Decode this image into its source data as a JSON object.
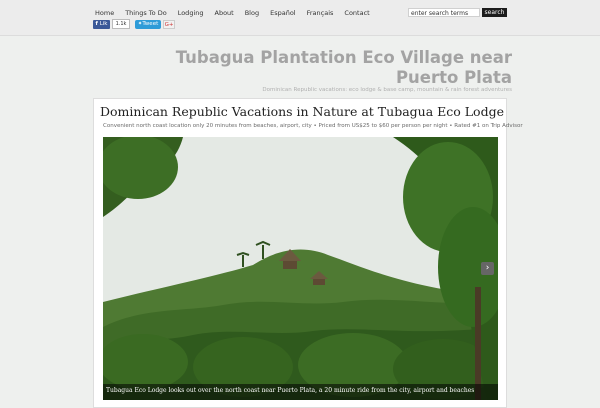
{
  "nav": {
    "items": [
      "Home",
      "Things To Do",
      "Lodging",
      "About",
      "Blog",
      "Español",
      "Français",
      "Contact"
    ]
  },
  "search": {
    "placeholder": "enter search terms",
    "button_label": "search"
  },
  "social": {
    "like_label": "Lik",
    "like_count": "1.1k",
    "tweet_label": "Tweet",
    "plus_label": "G+"
  },
  "header": {
    "title": "Tubagua Plantation Eco Village near Puerto Plata",
    "tagline": "Dominican Republic vacations: eco lodge & base camp, mountain & rain forest adventures"
  },
  "post": {
    "title": "Dominican Republic Vacations in Nature at Tubagua Eco Lodge",
    "subtitle": "Convenient north coast location only 20 minutes from beaches, airport, city • Priced from US$25 to $60 per person per night • Rated #1 on Trip Advisor",
    "photo_caption": "Tubagua Eco Lodge looks out over the north coast near Puerto Plata, a 20 minute ride from the city, airport and beaches"
  }
}
